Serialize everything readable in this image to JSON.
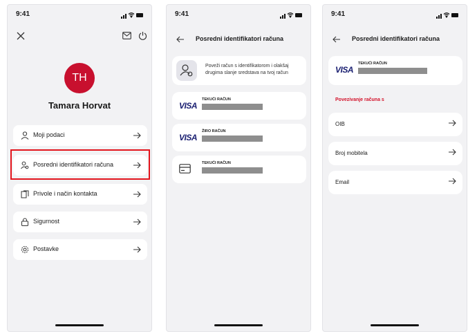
{
  "status": {
    "time": "9:41"
  },
  "screen1": {
    "avatar_initials": "TH",
    "user_name": "Tamara Horvat",
    "menu": [
      {
        "label": "Moji podaci",
        "icon": "user-icon"
      },
      {
        "label": "Posredni identifikatori računa",
        "icon": "users-icon"
      },
      {
        "label": "Privole i način kontakta",
        "icon": "consent-icon"
      },
      {
        "label": "Sigurnost",
        "icon": "lock-icon"
      },
      {
        "label": "Postavke",
        "icon": "gear-icon"
      }
    ],
    "highlighted_item": "Posredni identifikatori računa"
  },
  "screen2": {
    "title": "Posredni identifikatori računa",
    "info_text": "Poveži račun s identifikatorom i olakšaj drugima slanje sredstava na tvoj račun",
    "accounts": [
      {
        "brand": "VISA",
        "label": "TEKUĆI RAČUN"
      },
      {
        "brand": "VISA",
        "label": "ŽIRO RAČUN"
      },
      {
        "brand": "",
        "label": "TEKUĆI RAČUN",
        "icon": "card-icon"
      }
    ]
  },
  "screen3": {
    "title": "Posredni identifikatori računa",
    "account": {
      "brand": "VISA",
      "label": "TEKUĆI RAČUN"
    },
    "section_title": "Povezivanje računa s",
    "options": [
      {
        "label": "OIB"
      },
      {
        "label": "Broj mobitela"
      },
      {
        "label": "Email"
      }
    ]
  },
  "colors": {
    "accent_red": "#c8102e",
    "highlight_border": "#e3141c",
    "visa_blue": "#1a1f71",
    "background": "#f2f2f4"
  }
}
